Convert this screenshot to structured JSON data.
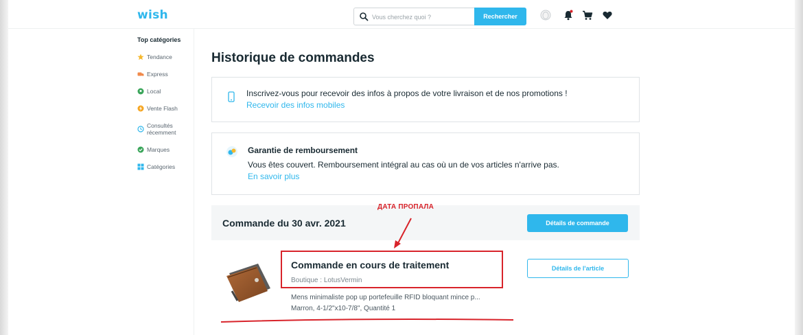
{
  "header": {
    "logo": "wish",
    "search": {
      "placeholder": "Vous cherchez quoi ?",
      "button_label": "Rechercher"
    }
  },
  "sidebar": {
    "title": "Top catégories",
    "items": [
      {
        "label": "Tendance",
        "icon": "star-icon",
        "color": "#f5b82e"
      },
      {
        "label": "Express",
        "icon": "truck-icon",
        "color": "#f08a4b"
      },
      {
        "label": "Local",
        "icon": "location-icon",
        "color": "#3aa55a"
      },
      {
        "label": "Vente Flash",
        "icon": "lightning-icon",
        "color": "#f5a623"
      },
      {
        "label": "Consultés\nrécemment",
        "icon": "clock-icon",
        "color": "#2fb7ec"
      },
      {
        "label": "Marques",
        "icon": "shield-check-icon",
        "color": "#3aa55a"
      },
      {
        "label": "Catégories",
        "icon": "grid-icon",
        "color": "#2fb7ec"
      }
    ]
  },
  "main": {
    "title": "Historique de commandes",
    "mobile_card": {
      "text": "Inscrivez-vous pour recevoir des infos à propos de votre livraison et de nos promotions !",
      "link": "Recevoir des infos mobiles"
    },
    "guarantee_card": {
      "title": "Garantie de remboursement",
      "text": "Vous êtes couvert. Remboursement intégral au cas où un de vos articles n'arrive pas.",
      "link": "En savoir plus"
    },
    "order": {
      "title": "Commande du 30 avr. 2021",
      "details_button": "Détails de commande",
      "item": {
        "status": "Commande en cours de traitement",
        "shop": "Boutique : LotusVermin",
        "description": "Mens minimaliste pop up portefeuille RFID bloquant mince p...",
        "variant": "Marron, 4-1/2\"x10-7/8\", Quantité 1",
        "details_button": "Détails de l'article"
      }
    }
  },
  "annotation": {
    "label": "ДАТА ПРОПАЛА",
    "color": "#d8232a"
  },
  "colors": {
    "accent": "#2fb7ec",
    "text": "#192a32",
    "annotation": "#d8232a"
  }
}
